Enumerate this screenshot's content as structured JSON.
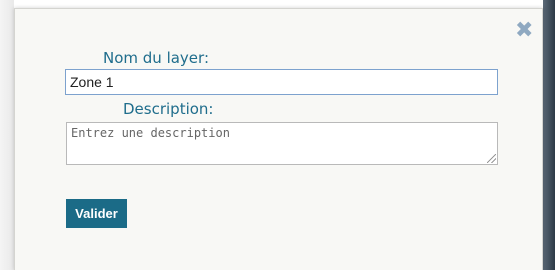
{
  "dialog": {
    "close_glyph": "✖",
    "name_label": "Nom du layer:",
    "name_value": "Zone 1",
    "description_label": "Description:",
    "description_placeholder": "Entrez une description",
    "submit_label": "Valider"
  },
  "colors": {
    "accent": "#1b6b87",
    "label_text": "#1f6d8c",
    "close_icon": "#8fa9c1"
  }
}
